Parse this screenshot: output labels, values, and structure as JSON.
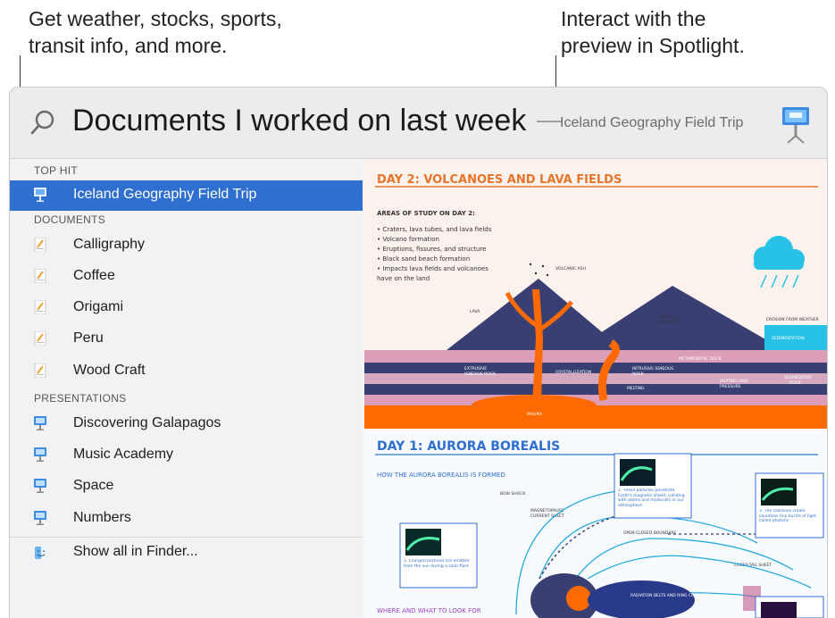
{
  "callouts": {
    "left_line1": "Get weather, stocks, sports,",
    "left_line2": "transit info, and more.",
    "right_line1": "Interact with the",
    "right_line2": "preview in Spotlight."
  },
  "search": {
    "query": "Documents I worked on last week",
    "separator": "—",
    "top_hit_name": "Iceland Geography Field Trip"
  },
  "sections": {
    "top_hit": "TOP HIT",
    "documents": "DOCUMENTS",
    "presentations": "PRESENTATIONS"
  },
  "results": {
    "top_hit": {
      "label": "Iceland Geography Field Trip",
      "icon": "keynote-icon"
    },
    "documents": [
      {
        "label": "Calligraphy",
        "icon": "pages-icon"
      },
      {
        "label": "Coffee",
        "icon": "pages-icon"
      },
      {
        "label": "Origami",
        "icon": "pages-icon"
      },
      {
        "label": "Peru",
        "icon": "pages-icon"
      },
      {
        "label": "Wood Craft",
        "icon": "pages-icon"
      }
    ],
    "presentations": [
      {
        "label": "Discovering Galapagos",
        "icon": "keynote-icon"
      },
      {
        "label": "Music Academy",
        "icon": "keynote-icon"
      },
      {
        "label": "Space",
        "icon": "keynote-icon"
      },
      {
        "label": "Numbers",
        "icon": "keynote-icon"
      }
    ],
    "show_all": {
      "label": "Show all in Finder...",
      "icon": "finder-icon"
    }
  },
  "preview": {
    "day2_title": "DAY 2: VOLCANOES AND LAVA FIELDS",
    "day2_heading": "AREAS OF STUDY ON DAY 2:",
    "day2_bullets": [
      "• Craters, lava tubes, and lava fields",
      "• Volcano formation",
      "• Eruptions, fissures, and structure",
      "• Black sand beach formation",
      "• Impacts lava fields and volcanoes",
      "  have on the land"
    ],
    "labels": {
      "volcanic_ash": "VOLCANIC ASH",
      "lava": "LAVA",
      "uplift": "UPLIFT TO",
      "surface": "SURFACE",
      "erosion": "EROSION FROM WEATHER",
      "sedimentation": "SEDIMENTATION",
      "metamorphic": "METAMORPHIC ROCK",
      "extrusive": "EXTRUSIVE",
      "igneous_rock": "IGNEOUS ROCK",
      "crystallization": "CRYSTALLIZATION",
      "intrusive": "INTRUSIVE IGNEOUS",
      "rock": "ROCK",
      "melting": "MELTING",
      "heating": "HEATING AND",
      "pressure": "PRESSURE",
      "sedimentary": "SEDIMENTARY",
      "sed_rock": "ROCK",
      "magma": "MAGMA"
    },
    "day1_title": "DAY 1: AURORA BOREALIS",
    "day1_heading": "HOW THE AURORA BOREALIS IS FORMED",
    "bow_shock": "BOW SHOCK",
    "magnetopause": "MAGNETOPAUSE",
    "current_sheet": "CURRENT SHEET",
    "open_closed": "OPEN-CLOSED BOUNDARY",
    "cross_tail": "CROSS-TAIL SHEET",
    "caption1": "1. Charged particles are emitted from the sun during a solar flare",
    "caption2": "2. These particles penetrate Earth's magnetic shield, colliding with atoms and molecules in our atmosphere",
    "caption3": "3. The collisions create countless tiny bursts of light called photons",
    "radiation": "RADIATION BELTS AND RING CURRENTS",
    "where_heading": "WHERE AND WHAT TO LOOK FOR"
  },
  "colors": {
    "selection": "#2f6fd0",
    "accent_orange": "#e8742a",
    "mountain": "#3a3f73",
    "lava": "#ff6a00",
    "cloud": "#27c2e6"
  }
}
